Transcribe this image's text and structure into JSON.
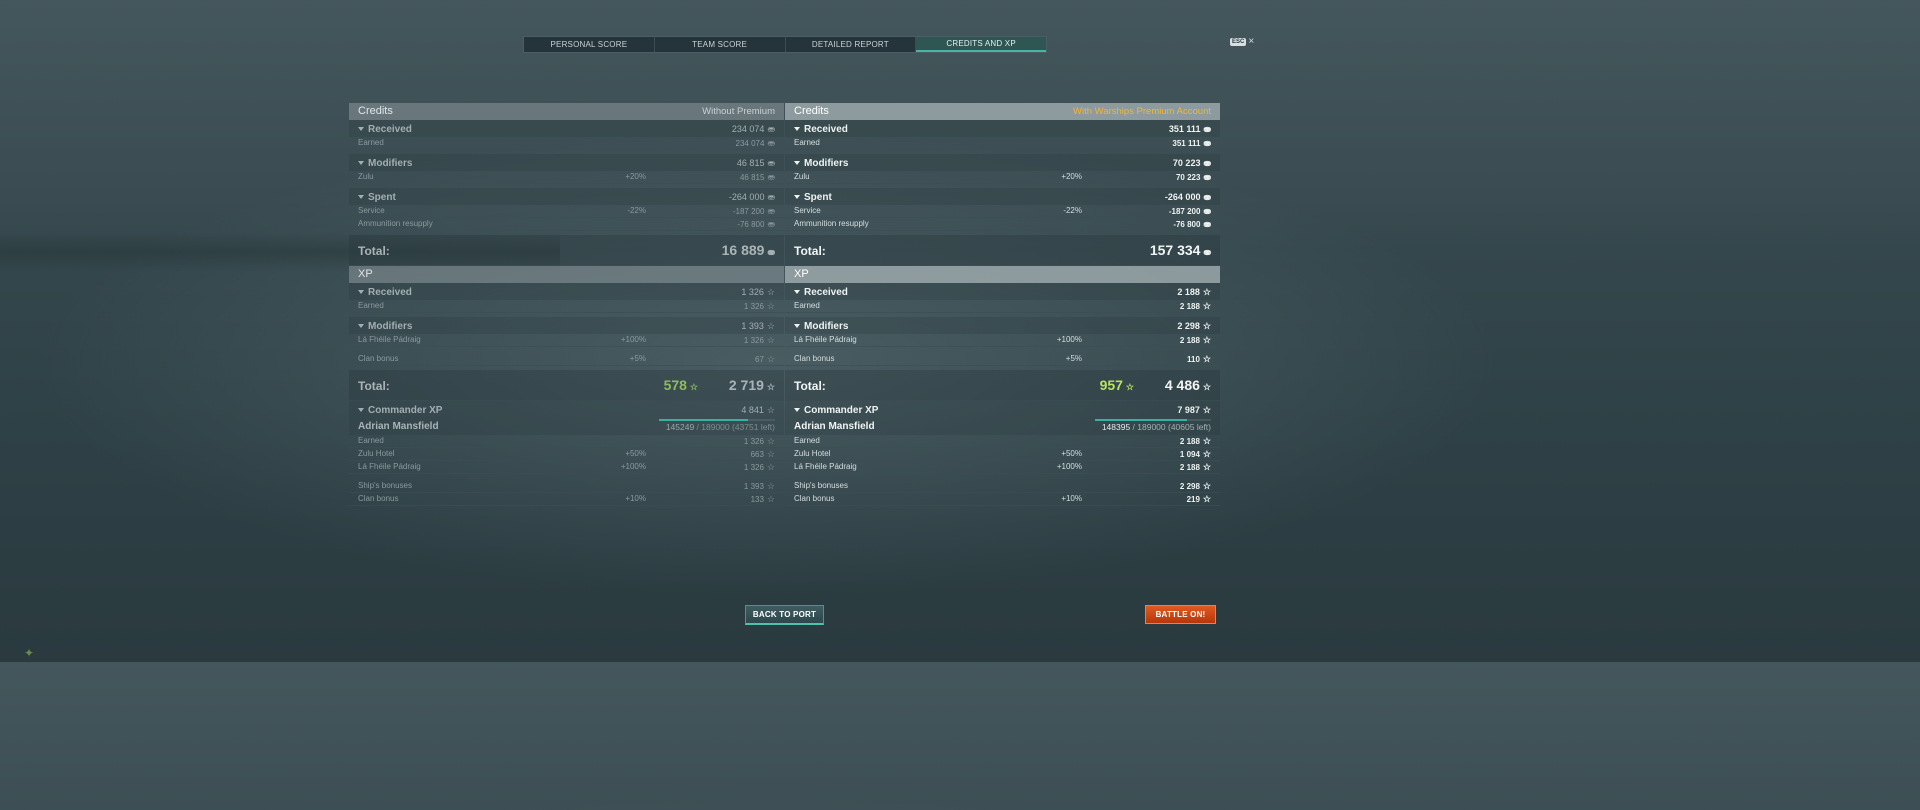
{
  "tabs": [
    "PERSONAL SCORE",
    "TEAM SCORE",
    "DETAILED REPORT",
    "CREDITS AND XP"
  ],
  "esc_label": "ESC",
  "left": {
    "credits_title": "Credits",
    "premium_label": "Without Premium",
    "received": {
      "label": "Received",
      "value": "234 074"
    },
    "earned": {
      "label": "Earned",
      "value": "234 074"
    },
    "modifiers": {
      "label": "Modifiers",
      "value": "46 815"
    },
    "zulu": {
      "label": "Zulu",
      "pct": "+20%",
      "value": "46 815"
    },
    "spent": {
      "label": "Spent",
      "value": "-264 000"
    },
    "service": {
      "label": "Service",
      "pct": "-22%",
      "value": "-187 200"
    },
    "ammo": {
      "label": "Ammunition resupply",
      "value": "-76 800"
    },
    "credits_total": {
      "label": "Total:",
      "value": "16 889"
    },
    "xp_title": "XP",
    "xp_received": {
      "label": "Received",
      "value": "1 326"
    },
    "xp_earned": {
      "label": "Earned",
      "value": "1 326"
    },
    "xp_modifiers": {
      "label": "Modifiers",
      "value": "1 393"
    },
    "xp_la": {
      "label": "Lá Fhéile Pádraig",
      "pct": "+100%",
      "value": "1 326"
    },
    "xp_clan": {
      "label": "Clan bonus",
      "pct": "+5%",
      "value": "67"
    },
    "xp_total": {
      "label": "Total:",
      "free": "578",
      "value": "2 719"
    },
    "cmdr_xp": {
      "label": "Commander XP",
      "value": "4 841"
    },
    "commander": {
      "name": "Adrian Mansfield",
      "current": "145249",
      "rest": " / 189000 (43751 left)",
      "progress": 0.77
    },
    "c_earned": {
      "label": "Earned",
      "value": "1 326"
    },
    "c_zulu": {
      "label": "Zulu Hotel",
      "pct": "+50%",
      "value": "663"
    },
    "c_la": {
      "label": "Lá Fhéile Pádraig",
      "pct": "+100%",
      "value": "1 326"
    },
    "c_ship": {
      "label": "Ship's bonuses",
      "value": "1 393"
    },
    "c_clan": {
      "label": "Clan bonus",
      "pct": "+10%",
      "value": "133"
    }
  },
  "right": {
    "credits_title": "Credits",
    "premium_label": "With Warships Premium Account",
    "received": {
      "label": "Received",
      "value": "351 111"
    },
    "earned": {
      "label": "Earned",
      "value": "351 111"
    },
    "modifiers": {
      "label": "Modifiers",
      "value": "70 223"
    },
    "zulu": {
      "label": "Zulu",
      "pct": "+20%",
      "value": "70 223"
    },
    "spent": {
      "label": "Spent",
      "value": "-264 000"
    },
    "service": {
      "label": "Service",
      "pct": "-22%",
      "value": "-187 200"
    },
    "ammo": {
      "label": "Ammunition resupply",
      "value": "-76 800"
    },
    "credits_total": {
      "label": "Total:",
      "value": "157 334"
    },
    "xp_title": "XP",
    "xp_received": {
      "label": "Received",
      "value": "2 188"
    },
    "xp_earned": {
      "label": "Earned",
      "value": "2 188"
    },
    "xp_modifiers": {
      "label": "Modifiers",
      "value": "2 298"
    },
    "xp_la": {
      "label": "Lá Fhéile Pádraig",
      "pct": "+100%",
      "value": "2 188"
    },
    "xp_clan": {
      "label": "Clan bonus",
      "pct": "+5%",
      "value": "110"
    },
    "xp_total": {
      "label": "Total:",
      "free": "957",
      "value": "4 486"
    },
    "cmdr_xp": {
      "label": "Commander XP",
      "value": "7 987"
    },
    "commander": {
      "name": "Adrian Mansfield",
      "current": "148395",
      "rest": " / 189000 (40605 left)",
      "progress": 0.79
    },
    "c_earned": {
      "label": "Earned",
      "value": "2 188"
    },
    "c_zulu": {
      "label": "Zulu Hotel",
      "pct": "+50%",
      "value": "1 094"
    },
    "c_la": {
      "label": "Lá Fhéile Pádraig",
      "pct": "+100%",
      "value": "2 188"
    },
    "c_ship": {
      "label": "Ship's bonuses",
      "value": "2 298"
    },
    "c_clan": {
      "label": "Clan bonus",
      "pct": "+10%",
      "value": "219"
    }
  },
  "buttons": {
    "back": "BACK TO PORT",
    "battle": "BATTLE ON!"
  },
  "icons": {
    "credits": "credits-coin-icon",
    "xp": "xp-star-icon"
  },
  "colors": {
    "accent": "#48b3a6",
    "premium": "#f2b632",
    "free_xp": "#b7e45c",
    "battle": "#d4491a"
  }
}
